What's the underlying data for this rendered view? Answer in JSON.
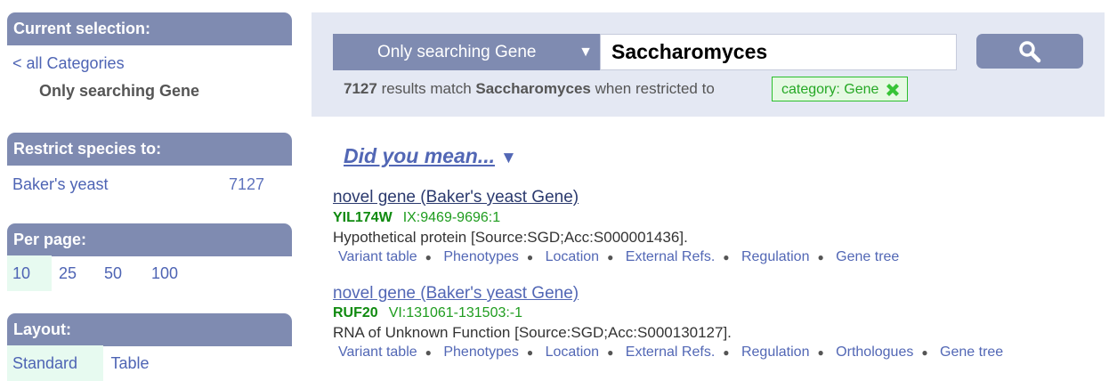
{
  "sidebar": {
    "current_selection": {
      "heading": "Current selection:",
      "back_link": "< all Categories",
      "current": "Only searching Gene"
    },
    "restrict_species": {
      "heading": "Restrict species to:",
      "items": [
        {
          "label": "Baker's yeast",
          "count": "7127"
        }
      ]
    },
    "per_page": {
      "heading": "Per page:",
      "options": [
        "10",
        "25",
        "50",
        "100"
      ],
      "selected": "10"
    },
    "layout": {
      "heading": "Layout:",
      "options": [
        "Standard",
        "Table"
      ],
      "selected": "Standard"
    }
  },
  "search": {
    "scope_label": "Only searching Gene",
    "query": "Saccharomyces",
    "button_icon": "magnifier-icon",
    "result_count": "7127",
    "results_text_mid": "results match",
    "results_query": "Saccharomyces",
    "results_text_end": "when restricted to",
    "filter_tag": "category: Gene"
  },
  "results": {
    "did_you_mean": "Did you mean...",
    "items": [
      {
        "title": "novel gene (Baker's yeast Gene)",
        "id": "YIL174W",
        "location": "IX:9469-9696:1",
        "description": "Hypothetical protein [Source:SGD;Acc:S000001436].",
        "links": [
          "Variant table",
          "Phenotypes",
          "Location",
          "External Refs.",
          "Regulation",
          "Gene tree"
        ]
      },
      {
        "title": "novel gene (Baker's yeast Gene)",
        "id": "RUF20",
        "location": "VI:131061-131503:-1",
        "description": "RNA of Unknown Function [Source:SGD;Acc:S000130127].",
        "links": [
          "Variant table",
          "Phenotypes",
          "Location",
          "External Refs.",
          "Regulation",
          "Orthologues",
          "Gene tree"
        ]
      }
    ]
  },
  "colors": {
    "panel_header": "#7f8bb1",
    "link": "#4e64b4",
    "selected_bg": "#e7faf0",
    "search_panel_bg": "#e4e8f3",
    "tag_green": "#25a825"
  }
}
